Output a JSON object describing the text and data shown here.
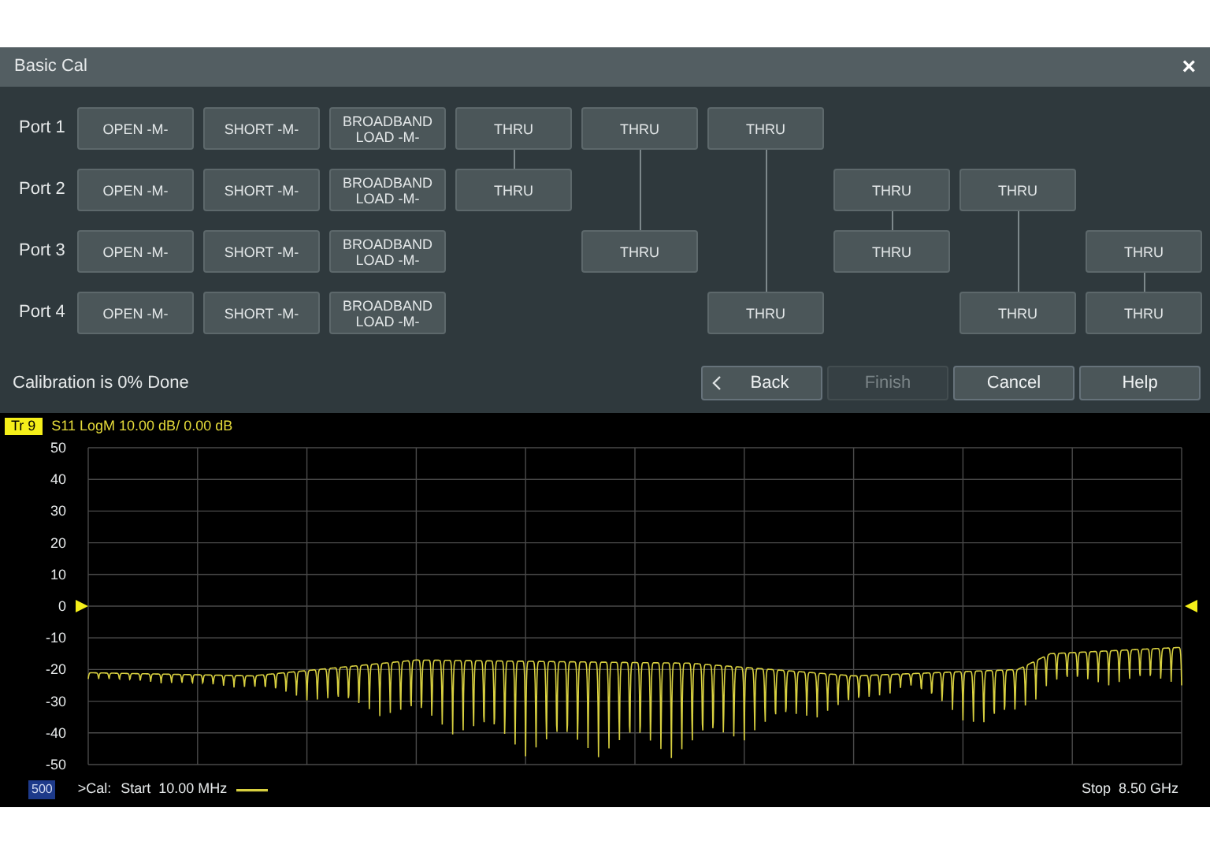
{
  "dialog": {
    "title": "Basic Cal",
    "close": "×"
  },
  "ports": [
    {
      "label": "Port 1",
      "standards": [
        "OPEN -M-",
        "SHORT -M-",
        "BROADBAND LOAD -M-"
      ]
    },
    {
      "label": "Port 2",
      "standards": [
        "OPEN -M-",
        "SHORT -M-",
        "BROADBAND LOAD -M-"
      ]
    },
    {
      "label": "Port 3",
      "standards": [
        "OPEN -M-",
        "SHORT -M-",
        "BROADBAND LOAD -M-"
      ]
    },
    {
      "label": "Port 4",
      "standards": [
        "OPEN -M-",
        "SHORT -M-",
        "BROADBAND LOAD -M-"
      ]
    }
  ],
  "thru_columns": [
    {
      "cells": [
        {
          "kind": "thru",
          "label": "THRU"
        },
        {
          "kind": "thru",
          "label": "THRU"
        },
        {
          "kind": "none"
        },
        {
          "kind": "none"
        }
      ]
    },
    {
      "cells": [
        {
          "kind": "thru",
          "label": "THRU"
        },
        {
          "kind": "link"
        },
        {
          "kind": "thru",
          "label": "THRU"
        },
        {
          "kind": "none"
        }
      ]
    },
    {
      "cells": [
        {
          "kind": "thru",
          "label": "THRU"
        },
        {
          "kind": "link"
        },
        {
          "kind": "link"
        },
        {
          "kind": "thru",
          "label": "THRU"
        }
      ]
    },
    {
      "cells": [
        {
          "kind": "none"
        },
        {
          "kind": "thru",
          "label": "THRU"
        },
        {
          "kind": "thru",
          "label": "THRU"
        },
        {
          "kind": "none"
        }
      ]
    },
    {
      "cells": [
        {
          "kind": "none"
        },
        {
          "kind": "thru",
          "label": "THRU"
        },
        {
          "kind": "link"
        },
        {
          "kind": "thru",
          "label": "THRU"
        }
      ]
    },
    {
      "cells": [
        {
          "kind": "none"
        },
        {
          "kind": "none"
        },
        {
          "kind": "thru",
          "label": "THRU"
        },
        {
          "kind": "thru",
          "label": "THRU"
        }
      ]
    }
  ],
  "status": "Calibration is 0% Done",
  "buttons": [
    {
      "label": "Back",
      "kind": "back",
      "disabled": false
    },
    {
      "label": "Finish",
      "kind": "plain",
      "disabled": true
    },
    {
      "label": "Cancel",
      "kind": "plain",
      "disabled": false
    },
    {
      "label": "Help",
      "kind": "plain",
      "disabled": false
    }
  ],
  "trace": {
    "tag": "Tr 9",
    "description": "S11 LogM 10.00 dB/ 0.00 dB",
    "y_labels": [
      "50",
      "40",
      "30",
      "20",
      "10",
      "0",
      "-10",
      "-20",
      "-30",
      "-40",
      "-50"
    ],
    "channel": "500",
    "cal": ">Cal:",
    "start": "Start  10.00 MHz",
    "stop": "Stop  8.50 GHz"
  }
}
